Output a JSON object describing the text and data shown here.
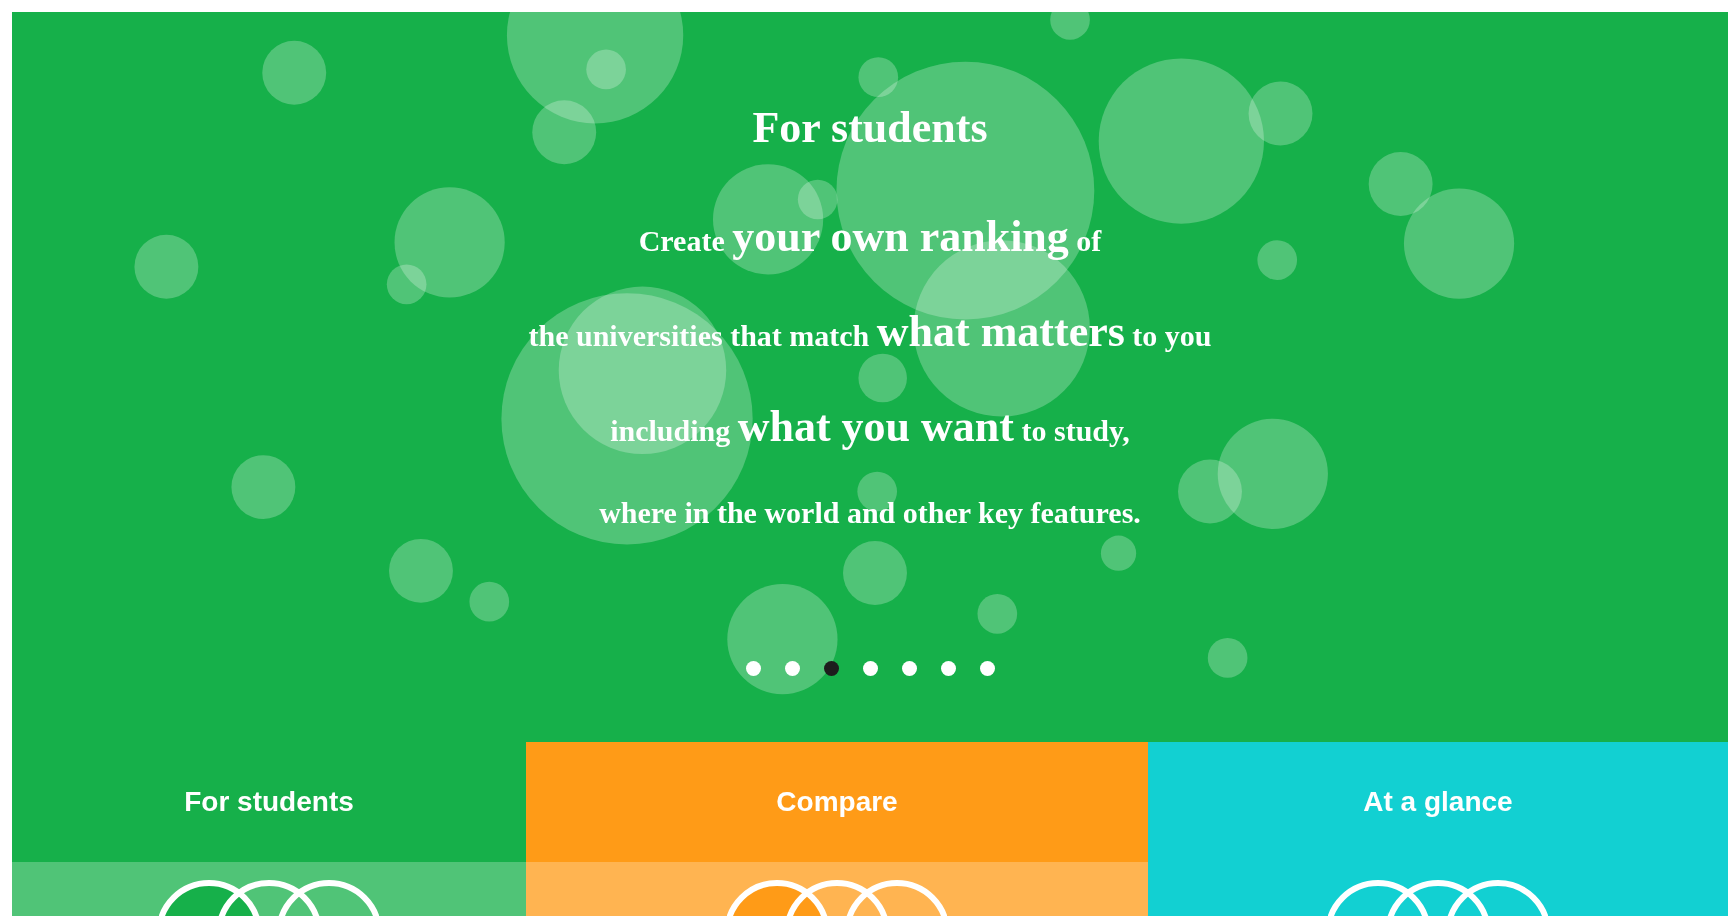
{
  "hero": {
    "title": "For students",
    "lines": [
      {
        "segments": [
          {
            "text": "Create",
            "emphasis": false
          },
          {
            "text": "your own ranking",
            "emphasis": true
          },
          {
            "text": "of",
            "emphasis": false
          }
        ]
      },
      {
        "segments": [
          {
            "text": "the universities that match",
            "emphasis": false
          },
          {
            "text": "what matters",
            "emphasis": true
          },
          {
            "text": "to you",
            "emphasis": false
          }
        ]
      },
      {
        "segments": [
          {
            "text": "including",
            "emphasis": false
          },
          {
            "text": "what you want",
            "emphasis": true
          },
          {
            "text": "to study,",
            "emphasis": false
          }
        ]
      },
      {
        "segments": [
          {
            "text": "where in the world and other key features.",
            "emphasis": false
          }
        ]
      }
    ],
    "dots": [
      {
        "selected": false
      },
      {
        "selected": false
      },
      {
        "selected": true
      },
      {
        "selected": false
      },
      {
        "selected": false
      },
      {
        "selected": false
      },
      {
        "selected": false
      }
    ]
  },
  "tabs": [
    {
      "label": "For students",
      "color": "#16b04a"
    },
    {
      "label": "Compare",
      "color": "#ff9b17"
    },
    {
      "label": "At a glance",
      "color": "#12d0d2"
    }
  ]
}
